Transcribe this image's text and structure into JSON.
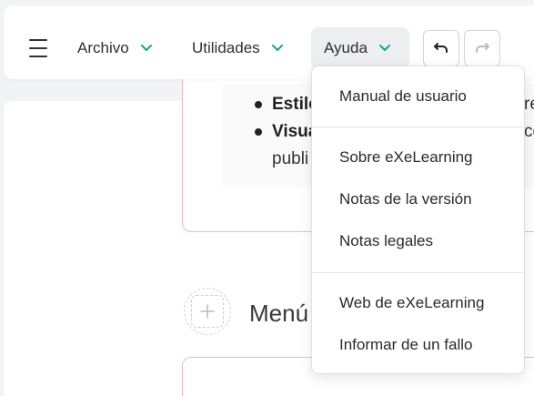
{
  "menubar": {
    "items": [
      {
        "label": "Archivo",
        "active": false
      },
      {
        "label": "Utilidades",
        "active": false
      },
      {
        "label": "Ayuda",
        "active": true
      }
    ],
    "undo_icon": "undo-icon",
    "redo_icon": "redo-icon"
  },
  "help_menu": {
    "group1": [
      "Manual de usuario"
    ],
    "group2": [
      "Sobre eXeLearning",
      "Notas de la versión",
      "Notas legales"
    ],
    "group3": [
      "Web de eXeLearning",
      "Informar de un fallo"
    ]
  },
  "content": {
    "bullets": [
      {
        "bold": "Estilo",
        "rest": "re"
      },
      {
        "bold": "Visua",
        "rest": "co"
      }
    ],
    "continuation": "publi",
    "section_title": "Menú",
    "add_block_icon": "plus-icon"
  },
  "colors": {
    "accent": "#1a9f9a",
    "card_border": "#f0b7bf",
    "active_menu_bg": "#edeef0"
  }
}
